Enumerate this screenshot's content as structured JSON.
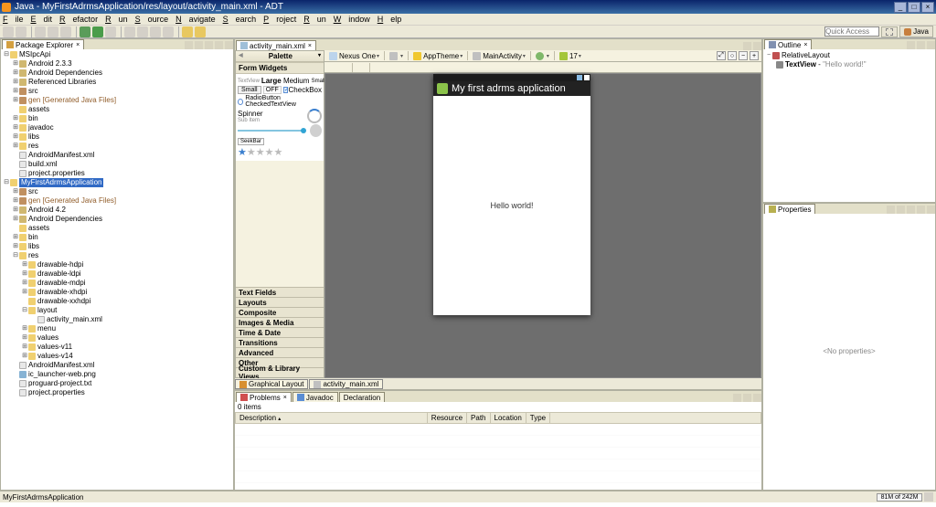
{
  "title": "Java - MyFirstAdrmsApplication/res/layout/activity_main.xml - ADT",
  "menus": [
    "File",
    "Edit",
    "Refactor",
    "Run",
    "Source",
    "Navigate",
    "Search",
    "Project",
    "Run",
    "Window",
    "Help"
  ],
  "quick_access_placeholder": "Quick Access",
  "perspective": "Java",
  "package_explorer_title": "Package Explorer",
  "tree": [
    {
      "lvl": 0,
      "exp": "-",
      "ico": "ico-proj",
      "label": "MSIpcApi"
    },
    {
      "lvl": 1,
      "exp": "+",
      "ico": "ico-jar",
      "label": "Android 2.3.3"
    },
    {
      "lvl": 1,
      "exp": "+",
      "ico": "ico-jar",
      "label": "Android Dependencies"
    },
    {
      "lvl": 1,
      "exp": "+",
      "ico": "ico-jar",
      "label": "Referenced Libraries"
    },
    {
      "lvl": 1,
      "exp": "+",
      "ico": "ico-src",
      "label": "src"
    },
    {
      "lvl": 1,
      "exp": "+",
      "ico": "ico-src",
      "label": "gen [Generated Java Files]",
      "gen": true
    },
    {
      "lvl": 1,
      "exp": "",
      "ico": "ico-folder",
      "label": "assets"
    },
    {
      "lvl": 1,
      "exp": "+",
      "ico": "ico-folder",
      "label": "bin"
    },
    {
      "lvl": 1,
      "exp": "+",
      "ico": "ico-folder",
      "label": "javadoc"
    },
    {
      "lvl": 1,
      "exp": "+",
      "ico": "ico-folder",
      "label": "libs"
    },
    {
      "lvl": 1,
      "exp": "+",
      "ico": "ico-folder",
      "label": "res"
    },
    {
      "lvl": 1,
      "exp": "",
      "ico": "ico-file",
      "label": "AndroidManifest.xml"
    },
    {
      "lvl": 1,
      "exp": "",
      "ico": "ico-file",
      "label": "build.xml"
    },
    {
      "lvl": 1,
      "exp": "",
      "ico": "ico-file",
      "label": "project.properties"
    },
    {
      "lvl": 0,
      "exp": "-",
      "ico": "ico-proj",
      "label": "MyFirstAdrmsApplication",
      "sel": true
    },
    {
      "lvl": 1,
      "exp": "+",
      "ico": "ico-src",
      "label": "src"
    },
    {
      "lvl": 1,
      "exp": "+",
      "ico": "ico-src",
      "label": "gen [Generated Java Files]",
      "gen": true
    },
    {
      "lvl": 1,
      "exp": "+",
      "ico": "ico-jar",
      "label": "Android 4.2"
    },
    {
      "lvl": 1,
      "exp": "+",
      "ico": "ico-jar",
      "label": "Android Dependencies"
    },
    {
      "lvl": 1,
      "exp": "",
      "ico": "ico-folder",
      "label": "assets"
    },
    {
      "lvl": 1,
      "exp": "+",
      "ico": "ico-folder",
      "label": "bin"
    },
    {
      "lvl": 1,
      "exp": "+",
      "ico": "ico-folder",
      "label": "libs"
    },
    {
      "lvl": 1,
      "exp": "-",
      "ico": "ico-folder",
      "label": "res"
    },
    {
      "lvl": 2,
      "exp": "+",
      "ico": "ico-folder",
      "label": "drawable-hdpi"
    },
    {
      "lvl": 2,
      "exp": "+",
      "ico": "ico-folder",
      "label": "drawable-ldpi"
    },
    {
      "lvl": 2,
      "exp": "+",
      "ico": "ico-folder",
      "label": "drawable-mdpi"
    },
    {
      "lvl": 2,
      "exp": "+",
      "ico": "ico-folder",
      "label": "drawable-xhdpi"
    },
    {
      "lvl": 2,
      "exp": "",
      "ico": "ico-folder",
      "label": "drawable-xxhdpi"
    },
    {
      "lvl": 2,
      "exp": "-",
      "ico": "ico-folder",
      "label": "layout"
    },
    {
      "lvl": 3,
      "exp": "",
      "ico": "ico-file",
      "label": "activity_main.xml"
    },
    {
      "lvl": 2,
      "exp": "+",
      "ico": "ico-folder",
      "label": "menu"
    },
    {
      "lvl": 2,
      "exp": "+",
      "ico": "ico-folder",
      "label": "values"
    },
    {
      "lvl": 2,
      "exp": "+",
      "ico": "ico-folder",
      "label": "values-v11"
    },
    {
      "lvl": 2,
      "exp": "+",
      "ico": "ico-folder",
      "label": "values-v14"
    },
    {
      "lvl": 1,
      "exp": "",
      "ico": "ico-file",
      "label": "AndroidManifest.xml"
    },
    {
      "lvl": 1,
      "exp": "",
      "ico": "ico-img",
      "label": "ic_launcher-web.png"
    },
    {
      "lvl": 1,
      "exp": "",
      "ico": "ico-file",
      "label": "proguard-project.txt"
    },
    {
      "lvl": 1,
      "exp": "",
      "ico": "ico-file",
      "label": "project.properties"
    }
  ],
  "editor_tab": "activity_main.xml",
  "palette": {
    "title": "Palette",
    "form_widgets": "Form Widgets",
    "textview": "TextView",
    "large": "Large",
    "medium": "Medium",
    "small": "Small",
    "button": "Button",
    "small_btn": "Small",
    "off": "OFF",
    "checkbox": "CheckBox",
    "radiobutton": "RadioButton CheckedTextView",
    "spinner": "Spinner",
    "subitem": "Sub Item",
    "seekbar": "SeekBar",
    "drawers": [
      "Text Fields",
      "Layouts",
      "Composite",
      "Images & Media",
      "Time & Date",
      "Transitions",
      "Advanced",
      "Other",
      "Custom & Library Views"
    ]
  },
  "designer_tb": {
    "device": "Nexus One",
    "theme": "AppTheme",
    "activity": "MainActivity",
    "api": "17"
  },
  "device": {
    "app_title": "My first adrms application",
    "content": "Hello world!"
  },
  "bottom_tabs": {
    "graphical": "Graphical Layout",
    "xml": "activity_main.xml"
  },
  "problems": {
    "tabs": [
      "Problems",
      "Javadoc",
      "Declaration"
    ],
    "summary": "0 items",
    "cols": [
      "Description",
      "Resource",
      "Path",
      "Location",
      "Type"
    ]
  },
  "outline": {
    "title": "Outline",
    "root": "RelativeLayout",
    "child": "TextView",
    "child_val": "\"Hello world!\""
  },
  "properties": {
    "title": "Properties",
    "empty": "<No properties>"
  },
  "status": {
    "selection": "MyFirstAdrmsApplication",
    "heap": "81M of 242M"
  }
}
